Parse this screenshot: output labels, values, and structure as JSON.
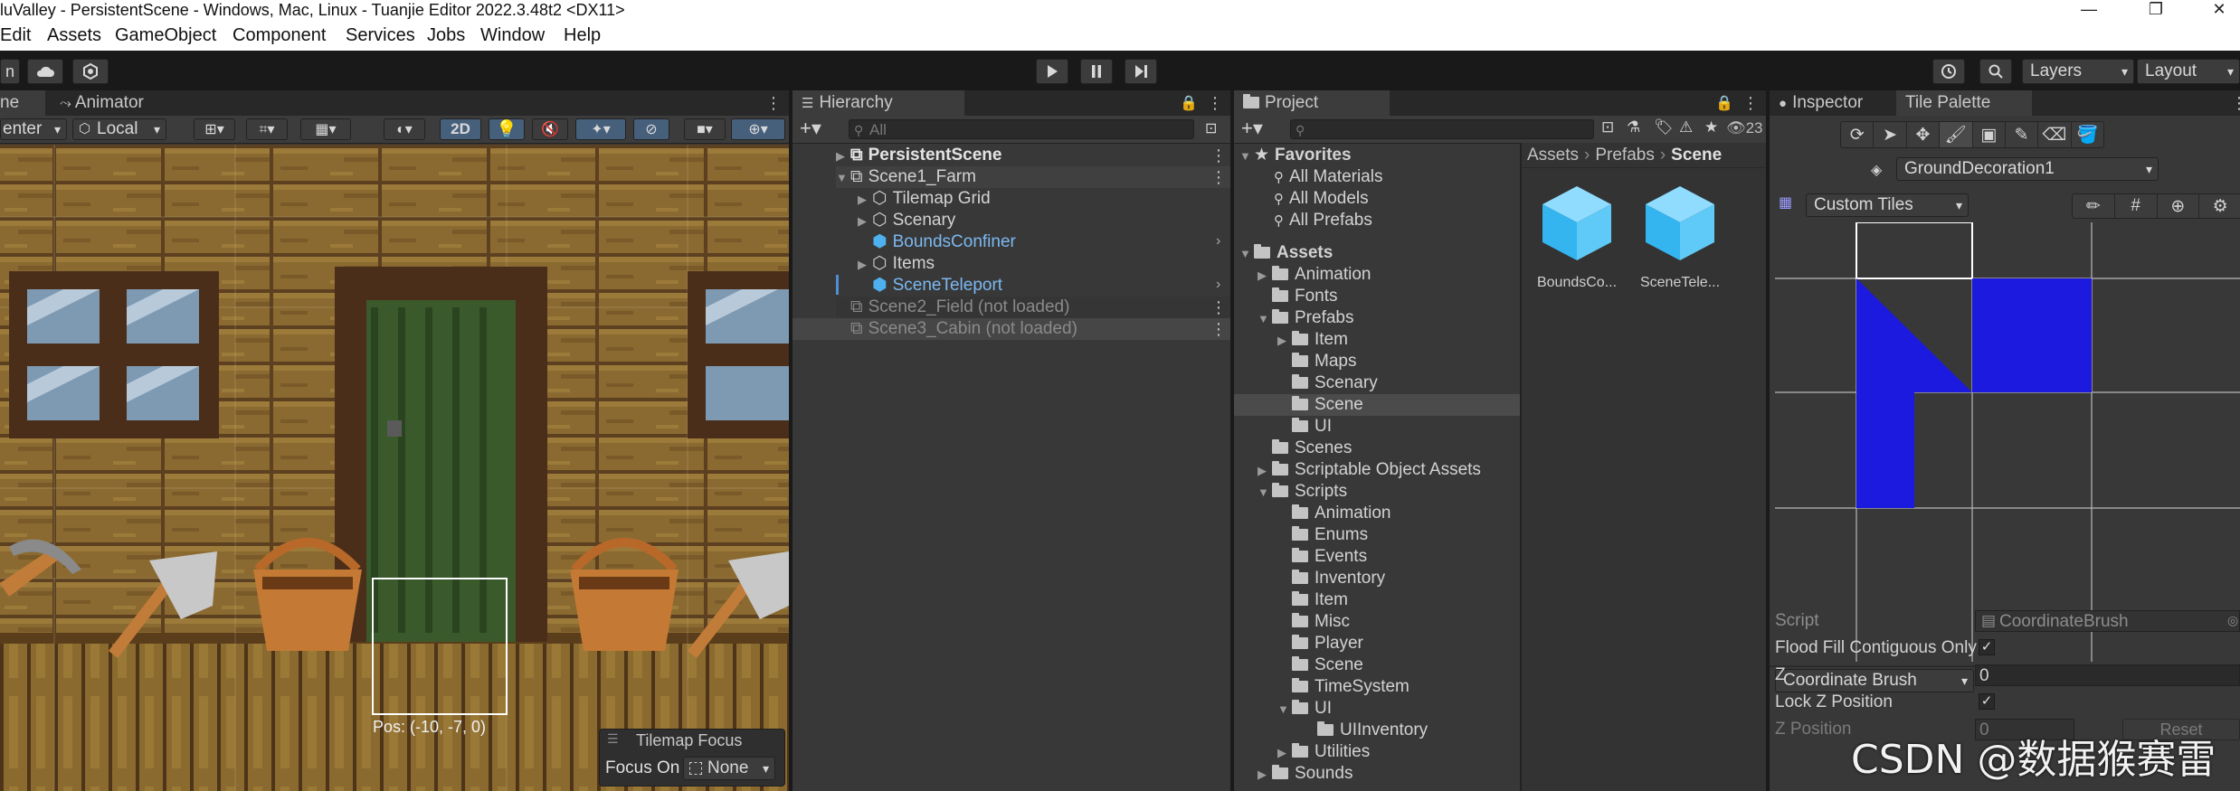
{
  "window": {
    "title": "luValley - PersistentScene - Windows, Mac, Linux - Tuanjie Editor 2022.3.48t2 <DX11>",
    "minimize": "—",
    "maximize": "❐",
    "close": "✕"
  },
  "menu": {
    "items": [
      "Edit",
      "Assets",
      "GameObject",
      "Component",
      "Services",
      "Jobs",
      "Window",
      "Help"
    ]
  },
  "toolbar": {
    "account_fragment": "n",
    "play_icon": "play-icon",
    "pause_icon": "pause-icon",
    "step_icon": "step-icon",
    "layers_label": "Layers",
    "layout_label": "Layout"
  },
  "scene_panel": {
    "tab_scene": "ne",
    "tab_animator": "Animator",
    "pivot": "enter",
    "space": "Local",
    "mode_2d": "2D",
    "pos_label": "Pos: (-10, -7, 0)",
    "overlay_title": "Tilemap Focus",
    "focus_label": "Focus On",
    "focus_value": "None"
  },
  "hierarchy": {
    "tab": "Hierarchy",
    "search_placeholder": "All",
    "items": [
      {
        "label": "PersistentScene",
        "kind": "scene-root"
      },
      {
        "label": "Scene1_Farm",
        "kind": "scene"
      },
      {
        "label": "Tilemap Grid",
        "kind": "object"
      },
      {
        "label": "Scenary",
        "kind": "object"
      },
      {
        "label": "BoundsConfiner",
        "kind": "prefab"
      },
      {
        "label": "Items",
        "kind": "object"
      },
      {
        "label": "SceneTeleport",
        "kind": "prefab"
      },
      {
        "label": "Scene2_Field (not loaded)",
        "kind": "unloaded"
      },
      {
        "label": "Scene3_Cabin (not loaded)",
        "kind": "unloaded"
      }
    ]
  },
  "project": {
    "tab": "Project",
    "count": "23",
    "breadcrumb": [
      "Assets",
      "Prefabs",
      "Scene"
    ],
    "favorites_header": "Favorites",
    "favorites": [
      "All Materials",
      "All Models",
      "All Prefabs"
    ],
    "assets_header": "Assets",
    "tree": [
      {
        "label": "Animation"
      },
      {
        "label": "Fonts"
      },
      {
        "label": "Prefabs"
      },
      {
        "label": "Item"
      },
      {
        "label": "Maps"
      },
      {
        "label": "Scenary"
      },
      {
        "label": "Scene"
      },
      {
        "label": "UI"
      },
      {
        "label": "Scenes"
      },
      {
        "label": "Scriptable Object Assets"
      },
      {
        "label": "Scripts"
      },
      {
        "label": "Animation"
      },
      {
        "label": "Enums"
      },
      {
        "label": "Events"
      },
      {
        "label": "Inventory"
      },
      {
        "label": "Item"
      },
      {
        "label": "Misc"
      },
      {
        "label": "Player"
      },
      {
        "label": "Scene"
      },
      {
        "label": "TimeSystem"
      },
      {
        "label": "UI"
      },
      {
        "label": "UIInventory"
      },
      {
        "label": "Utilities"
      },
      {
        "label": "Sounds"
      }
    ],
    "assets": [
      {
        "label": "BoundsCo..."
      },
      {
        "label": "SceneTele..."
      }
    ]
  },
  "inspector": {
    "tab_inspector": "Inspector",
    "tab_palette": "Tile Palette",
    "tilemap_target": "GroundDecoration1",
    "palette_select": "Custom Tiles",
    "brush_select": "Coordinate Brush",
    "props": {
      "script_label": "Script",
      "script_value": "CoordinateBrush",
      "flood_label": "Flood Fill Contiguous Only",
      "flood_checked": "✓",
      "z_label": "Z",
      "z_value": "0",
      "lockz_label": "Lock Z Position",
      "lockz_checked": "✓",
      "zpos_label": "Z Position",
      "zpos_value": "0",
      "reset_label": "Reset"
    },
    "tile_color": "#1d1ae0"
  },
  "watermark": "CSDN @数据猴赛雷"
}
